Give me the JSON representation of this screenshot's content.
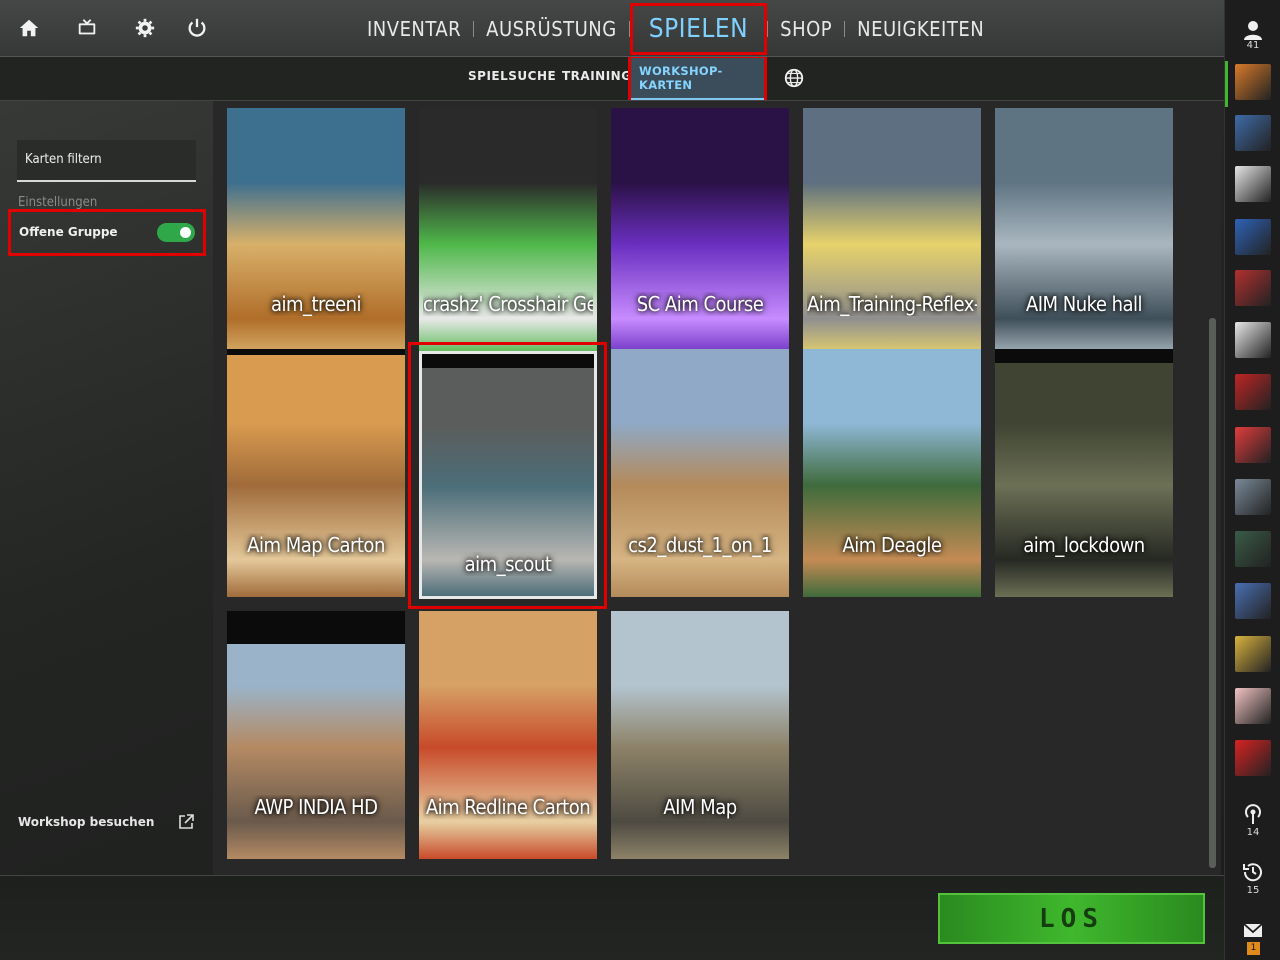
{
  "nav": {
    "items": [
      "INVENTAR",
      "AUSRÜSTUNG",
      "SPIELEN",
      "SHOP",
      "NEUIGKEITEN"
    ],
    "active": "SPIELEN"
  },
  "subnav": {
    "items": [
      "SPIELSUCHE",
      "TRAINING",
      "WORKSHOP-KARTEN"
    ],
    "active": "WORKSHOP-KARTEN"
  },
  "sidebar": {
    "filter_placeholder": "Karten filtern",
    "settings_label": "Einstellungen",
    "open_group_label": "Offene Gruppe",
    "open_group_on": true,
    "workshop_link": "Workshop besuchen"
  },
  "maps": [
    {
      "name": "aim_treeni",
      "colors": [
        "#3d6f8f",
        "#d8b06a",
        "#b06e2a"
      ]
    },
    {
      "name": "crashz' Crosshair Ge...",
      "colors": [
        "#2a2a2a",
        "#4fb84a",
        "#e8e8e8"
      ]
    },
    {
      "name": "SC Aim Course",
      "colors": [
        "#2a1146",
        "#6a2fbf",
        "#c78cff"
      ]
    },
    {
      "name": "Aim_Training-Reflex-...",
      "colors": [
        "#5d6f80",
        "#e7d26b",
        "#8f8f8f"
      ]
    },
    {
      "name": "AIM Nuke hall",
      "colors": [
        "#5f7483",
        "#aab7c0",
        "#3f4f59"
      ]
    },
    {
      "name": "Aim Map Carton",
      "colors": [
        "#d99b4f",
        "#a06b3a",
        "#e4c89a"
      ]
    },
    {
      "name": "aim_scout",
      "colors": [
        "#5a5d5c",
        "#4c6e79",
        "#b9b7b3"
      ]
    },
    {
      "name": "cs2_dust_1_on_1",
      "colors": [
        "#8fa9c6",
        "#b48a5a",
        "#d6b483"
      ]
    },
    {
      "name": "Aim Deagle",
      "colors": [
        "#8fb8d6",
        "#3f6b3c",
        "#c48b54"
      ]
    },
    {
      "name": "aim_lockdown",
      "colors": [
        "#3f4433",
        "#6c7055",
        "#262923"
      ]
    },
    {
      "name": "AWP INDIA HD",
      "colors": [
        "#9ab3c9",
        "#b48a63",
        "#6a5a4c"
      ]
    },
    {
      "name": "Aim Redline Carton",
      "colors": [
        "#d6a165",
        "#c84a2a",
        "#e7cfa1"
      ]
    },
    {
      "name": "AIM Map",
      "colors": [
        "#b3c4cf",
        "#8d8268",
        "#4d4a42"
      ]
    }
  ],
  "go_button": "LOS",
  "rail": {
    "friends_count": "41",
    "broadcast_count": "14",
    "history_count": "15",
    "mail_count": "1",
    "avatars": [
      "#d87a2a",
      "#3f6ba8",
      "#e6e6e6",
      "#2e63b8",
      "#b23030",
      "#e8e8e8",
      "#c02525",
      "#e03c3c",
      "#7a8a99",
      "#3a5b47",
      "#4a6fb3",
      "#d9b33f",
      "#f2c3c3",
      "#d82222"
    ]
  }
}
